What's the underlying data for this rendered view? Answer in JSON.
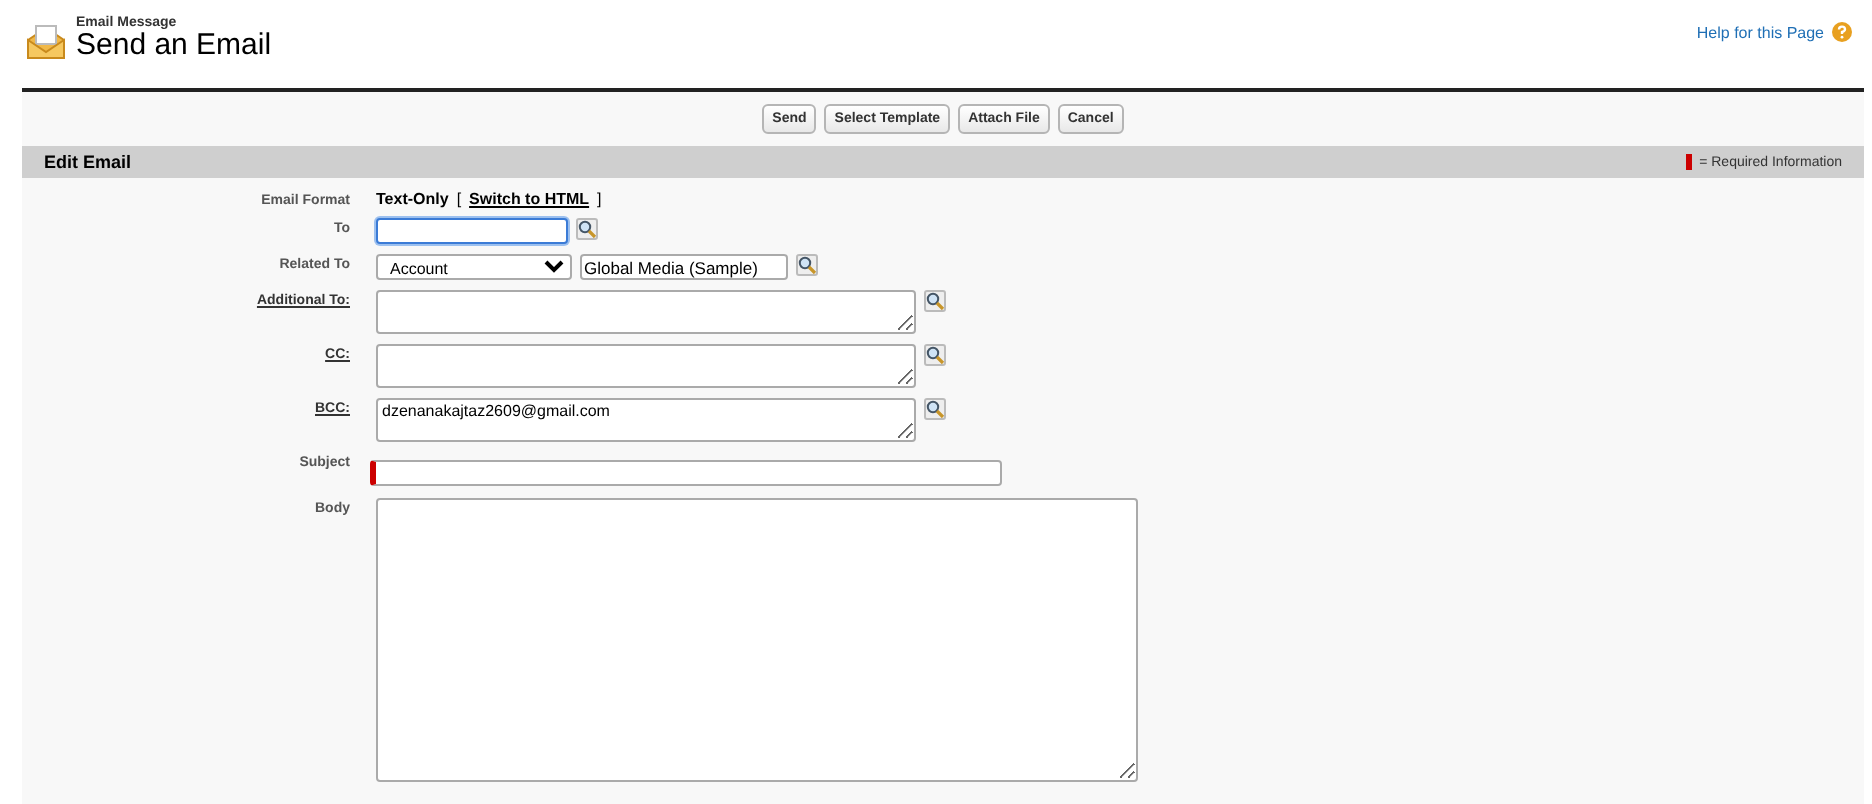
{
  "header": {
    "subtitle": "Email Message",
    "title": "Send an Email",
    "help_link": "Help for this Page"
  },
  "buttons": [
    "Send",
    "Select Template",
    "Attach File",
    "Cancel"
  ],
  "section": {
    "title": "Edit Email",
    "legend": "= Required Information"
  },
  "fields": [
    {
      "kind": "format",
      "label": "Email Format",
      "value": "Text-Only",
      "open": "[",
      "link": "Switch to HTML",
      "close": "]"
    },
    {
      "kind": "lookup",
      "label": "To",
      "focused": true
    },
    {
      "kind": "related",
      "label": "Related To",
      "select": "Account",
      "value": "Global Media (Sample)"
    },
    {
      "kind": "multi",
      "label": "Additional To:"
    },
    {
      "kind": "multi",
      "label": "CC:"
    },
    {
      "kind": "multi",
      "label": "BCC:",
      "value": "dzenanakajtaz2609@gmail.com"
    },
    {
      "kind": "subject",
      "label": "Subject",
      "required": true
    },
    {
      "kind": "body",
      "label": "Body"
    }
  ]
}
